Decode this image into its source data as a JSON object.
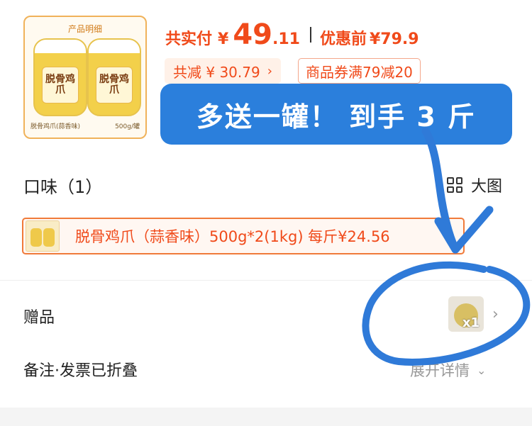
{
  "product": {
    "thumb_header": "产品明细",
    "jar_text": "脱骨鸡爪",
    "thumb_caption_left": "脱骨鸡爪(蒜香味)",
    "thumb_caption_right": "500g/罐"
  },
  "price": {
    "label": "共实付",
    "currency": "¥",
    "integer": "49",
    "decimal": ".11",
    "original_label": "优惠前",
    "original_price": "¥79.9"
  },
  "discounts": {
    "total_reduction": "共减 ¥ 30.79",
    "chevron": "›",
    "coupon": "商品券满79减20"
  },
  "quantity": {
    "plus": "+"
  },
  "callout": {
    "text": "多送一罐！ 到手 3 斤"
  },
  "flavor": {
    "title": "口味（1）",
    "bigview_label": "大图",
    "option_text": "脱骨鸡爪（蒜香味）500g*2(1kg) 每斤¥24.56"
  },
  "gift": {
    "label": "赠品",
    "qty": "x1",
    "chevron": "›"
  },
  "notes": {
    "label": "备注·发票已折叠",
    "expand_label": "展开详情",
    "chevron": "⌄"
  },
  "colors": {
    "accent_red": "#f04a1a",
    "callout_blue": "#2b7fdc",
    "annotation_blue": "#2f7ad8"
  }
}
